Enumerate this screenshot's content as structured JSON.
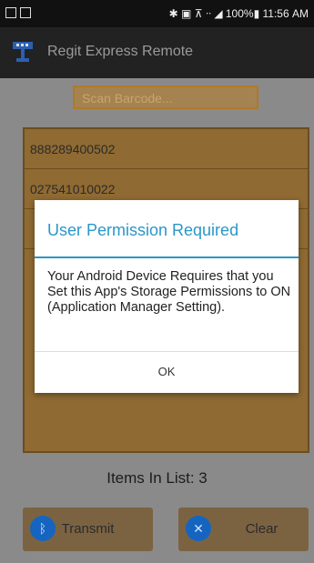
{
  "status_bar": {
    "text": "✱ ▣ ⊼ ᐧᐧ ◢ 100%▮ 11:56 AM"
  },
  "app": {
    "title": "Regit Express Remote"
  },
  "scan": {
    "placeholder": "Scan Barcode..."
  },
  "list": {
    "items": [
      "888289400502",
      "027541010022",
      ""
    ]
  },
  "items_count_text": "Items In List: 3",
  "buttons": {
    "transmit": "Transmit",
    "clear": "Clear"
  },
  "dialog": {
    "title": "User Permission Required",
    "message": "Your Android Device Requires that you Set this App's Storage Permissions to ON (Application Manager Setting).",
    "ok_label": "OK"
  },
  "colors": {
    "accent": "#2a97c9",
    "icon_blue": "#1565c0"
  },
  "icons": {
    "app_logo": "antenna-icon",
    "transmit": "bluetooth-icon",
    "clear": "close-icon"
  }
}
